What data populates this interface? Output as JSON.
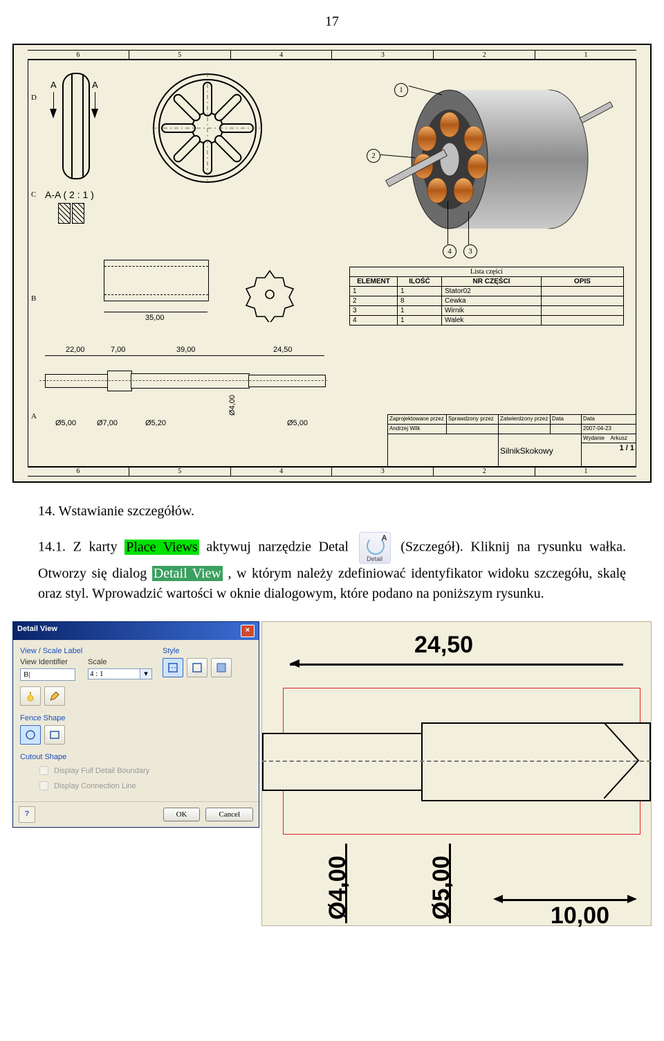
{
  "page_number": "17",
  "drawing": {
    "ruler": [
      "6",
      "5",
      "4",
      "3",
      "2",
      "1"
    ],
    "rows": [
      "D",
      "C",
      "B",
      "A"
    ],
    "arrows": {
      "a1": "A",
      "a2": "A"
    },
    "section_label": "A-A ( 2 : 1 )",
    "dims": {
      "rect_w": "35,00",
      "shaft_22": "22,00",
      "shaft_7": "7,00",
      "shaft_39": "39,00",
      "shaft_245": "24,50",
      "d5a": "Ø5,00",
      "d7": "Ø7,00",
      "d52": "Ø5,20",
      "d4": "Ø4,00",
      "d5b": "Ø5,00"
    },
    "balloons": [
      "1",
      "2",
      "3",
      "4"
    ],
    "parts_caption": "Lista części",
    "parts_headers": [
      "ELEMENT",
      "ILOŚĆ",
      "NR CZĘŚCI",
      "OPIS"
    ],
    "parts_rows": [
      [
        "1",
        "1",
        "Stator02",
        ""
      ],
      [
        "2",
        "8",
        "Cewka",
        ""
      ],
      [
        "3",
        "1",
        "Wirnik",
        ""
      ],
      [
        "4",
        "1",
        "Walek",
        ""
      ]
    ],
    "titleblock": {
      "r1c1": "Zaprojektowane przez",
      "r1c2": "Sprawdzony przez",
      "r1c3": "Zatwierdzony przez",
      "r1c4": "Data",
      "r1c5": "Data",
      "author": "Andrzej Wilk",
      "date": "2007-04-23",
      "name": "SilnikSkokowy",
      "wyd_h": "Wydanie",
      "ark_h": "Arkusz",
      "ark": "1 / 1"
    }
  },
  "text": {
    "heading": "14. Wstawianie szczegółów.",
    "p_pre": "14.1. Z karty ",
    "p_hl1": "Place Views",
    "p_mid1": " aktywuj narzędzie Detal ",
    "icon_label": "Detail",
    "p_mid2": " (Szczegół). Kliknij na rysunku wałka. Otworzy się dialog ",
    "p_hl2": "Detail View",
    "p_post": ", w którym należy zdefiniować identyfikator widoku szczegółu, skalę oraz styl. Wprowadzić wartości w oknie dialogowym, które podano na poniższym rysunku."
  },
  "dialog": {
    "title": "Detail View",
    "group_view": "View / Scale Label",
    "group_style": "Style",
    "lbl_identifier": "View Identifier",
    "lbl_scale": "Scale",
    "val_identifier": "B|",
    "val_scale": "4 : 1",
    "sect_fence": "Fence Shape",
    "sect_cutout": "Cutout Shape",
    "chk1": "Display Full Detail Boundary",
    "chk2": "Display Connection Line",
    "btn_ok": "OK",
    "btn_cancel": "Cancel"
  },
  "preview": {
    "dim_top": "24,50",
    "dim_d4": "Ø4,00",
    "dim_d5": "Ø5,00",
    "dim_10": "10,00"
  }
}
